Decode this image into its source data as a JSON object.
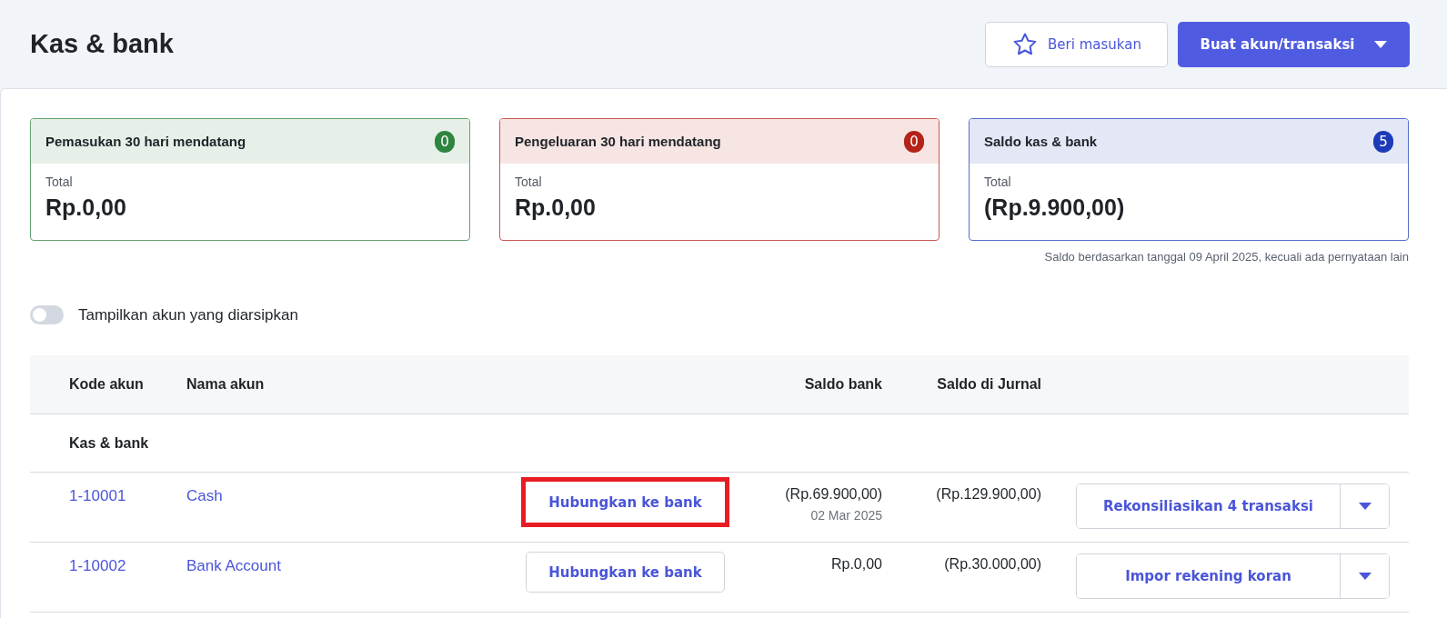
{
  "page": {
    "title": "Kas & bank"
  },
  "header_buttons": {
    "feedback": "Beri masukan",
    "create": "Buat akun/transaksi"
  },
  "summary_cards": [
    {
      "title": "Pemasukan 30 hari mendatang",
      "count": "0",
      "color": "#2e8540",
      "label": "Total",
      "amount": "Rp.0,00"
    },
    {
      "title": "Pengeluaran 30 hari mendatang",
      "count": "0",
      "color": "#b42318",
      "label": "Total",
      "amount": "Rp.0,00"
    },
    {
      "title": "Saldo kas & bank",
      "count": "5",
      "color": "#1d3bb8",
      "label": "Total",
      "amount": "(Rp.9.900,00)"
    }
  ],
  "balance_note": "Saldo berdasarkan tanggal 09 April 2025, kecuali ada pernyataan lain",
  "archive_toggle": {
    "label": "Tampilkan akun yang diarsipkan",
    "on": false
  },
  "table": {
    "columns": [
      "Kode akun",
      "Nama akun",
      "Saldo bank",
      "Saldo di Jurnal"
    ],
    "group": "Kas & bank",
    "rows": [
      {
        "code": "1-10001",
        "name": "Cash",
        "connect": "Hubungkan ke bank",
        "highlighted": true,
        "bank_balance": "(Rp.69.900,00)",
        "bank_date": "02 Mar 2025",
        "journal_balance": "(Rp.129.900,00)",
        "action": "Rekonsiliasikan 4 transaksi"
      },
      {
        "code": "1-10002",
        "name": "Bank Account",
        "connect": "Hubungkan ke bank",
        "highlighted": false,
        "bank_balance": "Rp.0,00",
        "journal_balance": "(Rp.30.000,00)",
        "action": "Impor rekening koran"
      }
    ]
  }
}
